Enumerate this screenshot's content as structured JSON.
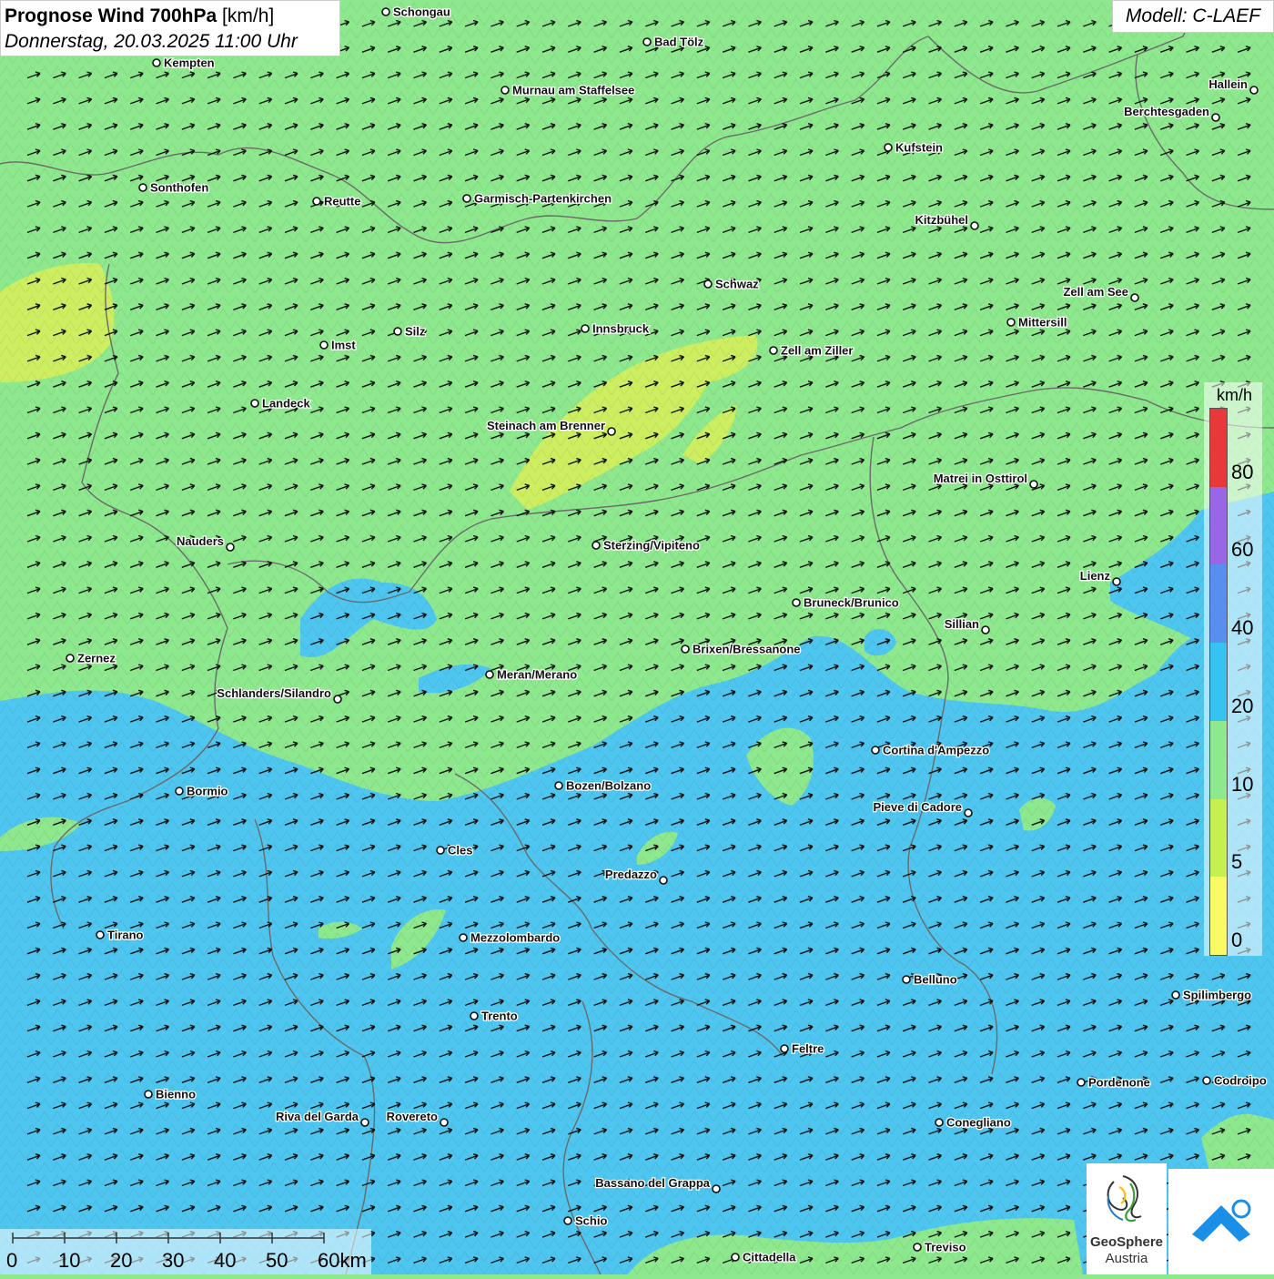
{
  "title": {
    "bold": "Prognose Wind 700hPa",
    "unit": "[km/h]",
    "date": "Donnerstag, 20.03.2025 11:00 Uhr"
  },
  "model": "Modell: C-LAEF",
  "legend": {
    "unit": "km/h",
    "labels": [
      "80",
      "60",
      "40",
      "20",
      "10",
      "5",
      "0"
    ],
    "colors": [
      "#e8383a",
      "#9966e6",
      "#5a8df0",
      "#36c3f2",
      "#8ee88e",
      "#c6ef52",
      "#fafa64"
    ]
  },
  "scalebar": {
    "labels": [
      "0",
      "10",
      "20",
      "30",
      "40",
      "50",
      "60km"
    ]
  },
  "field_colors": {
    "green": "#8ee88e",
    "blue": "#4ec6f0",
    "yellow": "#cdee60"
  },
  "cities": [
    {
      "name": "Schongau",
      "label": "Schongau"
    },
    {
      "name": "Bad Tölz",
      "label": "Bad Tölz"
    },
    {
      "name": "Kempten",
      "label": "Kempten"
    },
    {
      "name": "Murnau am Staffelsee",
      "label": "Murnau am Staffelsee"
    },
    {
      "name": "Hallein",
      "label": "Hallein"
    },
    {
      "name": "Berchtesgaden",
      "label": "Berchtesgaden"
    },
    {
      "name": "Kufstein",
      "label": "Kufstein"
    },
    {
      "name": "Sonthofen",
      "label": "Sonthofen"
    },
    {
      "name": "Reutte",
      "label": "Reutte"
    },
    {
      "name": "Garmisch-Partenkirchen",
      "label": "Garmisch-Partenkirchen"
    },
    {
      "name": "Kitzbühel",
      "label": "Kitzbühel"
    },
    {
      "name": "Schwaz",
      "label": "Schwaz"
    },
    {
      "name": "Zell am See",
      "label": "Zell am See"
    },
    {
      "name": "Mittersill",
      "label": "Mittersill"
    },
    {
      "name": "Silz",
      "label": "Silz"
    },
    {
      "name": "Innsbruck",
      "label": "Innsbruck"
    },
    {
      "name": "Imst",
      "label": "Imst"
    },
    {
      "name": "Zell am Ziller",
      "label": "Zell am Ziller"
    },
    {
      "name": "Landeck",
      "label": "Landeck"
    },
    {
      "name": "Steinach am Brenner",
      "label": "Steinach am Brenner"
    },
    {
      "name": "Matrei in Osttirol",
      "label": "Matrei in Osttirol"
    },
    {
      "name": "Nauders",
      "label": "Nauders"
    },
    {
      "name": "Sterzing/Vipiteno",
      "label": "Sterzing/Vipiteno"
    },
    {
      "name": "Lienz",
      "label": "Lienz"
    },
    {
      "name": "Bruneck/Brunico",
      "label": "Bruneck/Brunico"
    },
    {
      "name": "Sillian",
      "label": "Sillian"
    },
    {
      "name": "Zernez",
      "label": "Zernez"
    },
    {
      "name": "Brixen/Bressanone",
      "label": "Brixen/Bressanone"
    },
    {
      "name": "Meran/Merano",
      "label": "Meran/Merano"
    },
    {
      "name": "Schlanders/Silandro",
      "label": "Schlanders/Silandro"
    },
    {
      "name": "Cortina d'Ampezzo",
      "label": "Cortina d'Ampezzo"
    },
    {
      "name": "Bozen/Bolzano",
      "label": "Bozen/Bolzano"
    },
    {
      "name": "Bormio",
      "label": "Bormio"
    },
    {
      "name": "Pieve di Cadore",
      "label": "Pieve di Cadore"
    },
    {
      "name": "Cles",
      "label": "Cles"
    },
    {
      "name": "Predazzo",
      "label": "Predazzo"
    },
    {
      "name": "Tirano",
      "label": "Tirano"
    },
    {
      "name": "Mezzolombardo",
      "label": "Mezzolombardo"
    },
    {
      "name": "Belluno",
      "label": "Belluno"
    },
    {
      "name": "Spilimbergo",
      "label": "Spilimbergo"
    },
    {
      "name": "Trento",
      "label": "Trento"
    },
    {
      "name": "Feltre",
      "label": "Feltre"
    },
    {
      "name": "Pordenone",
      "label": "Pordenone"
    },
    {
      "name": "Codroipo",
      "label": "Codroipo"
    },
    {
      "name": "Bienno",
      "label": "Bienno"
    },
    {
      "name": "Riva del Garda",
      "label": "Riva del Garda"
    },
    {
      "name": "Rovereto",
      "label": "Rovereto"
    },
    {
      "name": "Conegliano",
      "label": "Conegliano"
    },
    {
      "name": "Bassano del Grappa",
      "label": "Bassano del Grappa"
    },
    {
      "name": "Schio",
      "label": "Schio"
    },
    {
      "name": "Treviso",
      "label": "Treviso"
    },
    {
      "name": "Cittadella",
      "label": "Cittadella"
    }
  ],
  "logo": {
    "line1": "GeoSphere",
    "line2": "Austria",
    "icon": "geosphere-logo-icon",
    "app_icon": "weather-app-icon"
  },
  "wind": {
    "direction": "west-southwest",
    "arrow_icon": "wind-arrow-icon"
  }
}
